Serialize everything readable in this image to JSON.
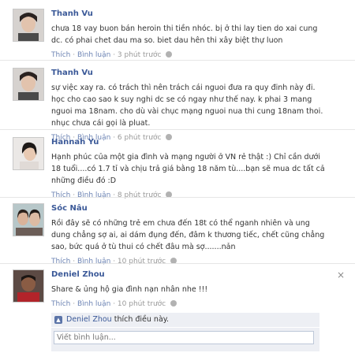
{
  "comments": [
    {
      "name": "Thanh Vu",
      "text": "chưa 18 vay buon bán heroin thi tiền nhóc. bị ở thi lay tien do xai cung dc. có phai chet dau ma so. biet dau hên thi xây biệt thự luon",
      "actions": {
        "like": "Thích",
        "reply": "Bình luận",
        "time": "3 phút trước"
      }
    },
    {
      "name": "Thanh Vu",
      "text": "sự việc xay ra. có trách thì nên trách cái nguoi đưa ra quy đinh này đi. học cho cao sao k suy nghi dc se có ngay như thế nay. k phai 3 mang nguoi ma 18nam. cho dù vài chục mạng nguoi nua thi cung 18nam thoi. nhục chưa cái gọi là pluat.",
      "actions": {
        "like": "Thích",
        "reply": "Bình luận",
        "time": "6 phút trước"
      }
    },
    {
      "name": "Hannah Yu",
      "text": "Hạnh phúc của một gia đình và mạng người ở VN rẻ thật :) Chỉ cần dưới 18 tuổi....có 1.7 tỉ và chịu trả giá bằng 18 năm tù....bạn sẽ mua dc tất cả những điều đó :D",
      "actions": {
        "like": "Thích",
        "reply": "Bình luận",
        "time": "8 phút trước"
      }
    },
    {
      "name": "Sóc Nâu",
      "text": "Rồi đây sẽ có những trẻ em chưa đến 18t có thể nganh nhiên và ung dung chẳng sợ ai, ai dám đụng đến, đâm k thương tiếc, chết cũng chẳng sao, bức quá ở tù thui có chết đâu mà sợ.......nản",
      "actions": {
        "like": "Thích",
        "reply": "Bình luận",
        "time": "10 phút trước"
      }
    },
    {
      "name": "Deniel Zhou",
      "text": "Share & ủng hộ gia đình nạn nhân nhe !!!",
      "actions": {
        "like": "Thích",
        "reply": "Bình luận",
        "time": "10 phút trước"
      }
    }
  ],
  "close_glyph": "×",
  "like_summary": {
    "name": "Deniel Zhou",
    "suffix": "thích điều này."
  },
  "reply": {
    "placeholder": "Viết bình luận..."
  },
  "colors": {
    "link": "#3b5998",
    "meta": "#999999",
    "box": "#edeff4"
  }
}
